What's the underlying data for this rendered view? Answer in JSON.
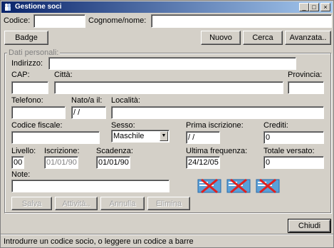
{
  "window": {
    "title": "Gestione soci"
  },
  "search": {
    "codice_label": "Codice:",
    "codice_value": "",
    "cognome_label": "Cognome/nome:",
    "cognome_value": ""
  },
  "toolbar": {
    "badge": "Badge",
    "nuovo": "Nuovo",
    "cerca": "Cerca",
    "avanzata": "Avanzata.."
  },
  "personal": {
    "group_title": "Dati personali:",
    "indirizzo_label": "Indirizzo:",
    "indirizzo_value": "",
    "cap_label": "CAP:",
    "cap_value": "",
    "citta_label": "Città:",
    "citta_value": "",
    "provincia_label": "Provincia:",
    "provincia_value": "",
    "telefono_label": "Telefono:",
    "telefono_value": "",
    "nato_label": "Nato/a il:",
    "nato_value": " / /",
    "localita_label": "Località:",
    "localita_value": "",
    "cf_label": "Codice fiscale:",
    "cf_value": "",
    "sesso_label": "Sesso:",
    "sesso_value": "Maschile",
    "prima_label": "Prima iscrizione:",
    "prima_value": " / /",
    "crediti_label": "Crediti:",
    "crediti_value": "0",
    "livello_label": "Livello:",
    "livello_value": "00",
    "iscrizione_label": "Iscrizione:",
    "iscrizione_value": "01/01/90",
    "scadenza_label": "Scadenza:",
    "scadenza_value": "01/01/90",
    "ultima_label": "Ultima frequenza:",
    "ultima_value": "24/12/05",
    "totale_label": "Totale versato:",
    "totale_value": "0",
    "note_label": "Note:",
    "note_value": ""
  },
  "actions": {
    "salva": "Salva",
    "attivita": "Attività..",
    "annulla": "Annulla",
    "elimina": "Elimina",
    "chiudi": "Chiudi"
  },
  "status": "Introdurre un codice socio, o leggere un codice a barre",
  "colors": {
    "titlebar_start": "#0a246a",
    "titlebar_end": "#a6caf0",
    "card_blue": "#5aa0d8",
    "cross_red": "#e02020"
  }
}
